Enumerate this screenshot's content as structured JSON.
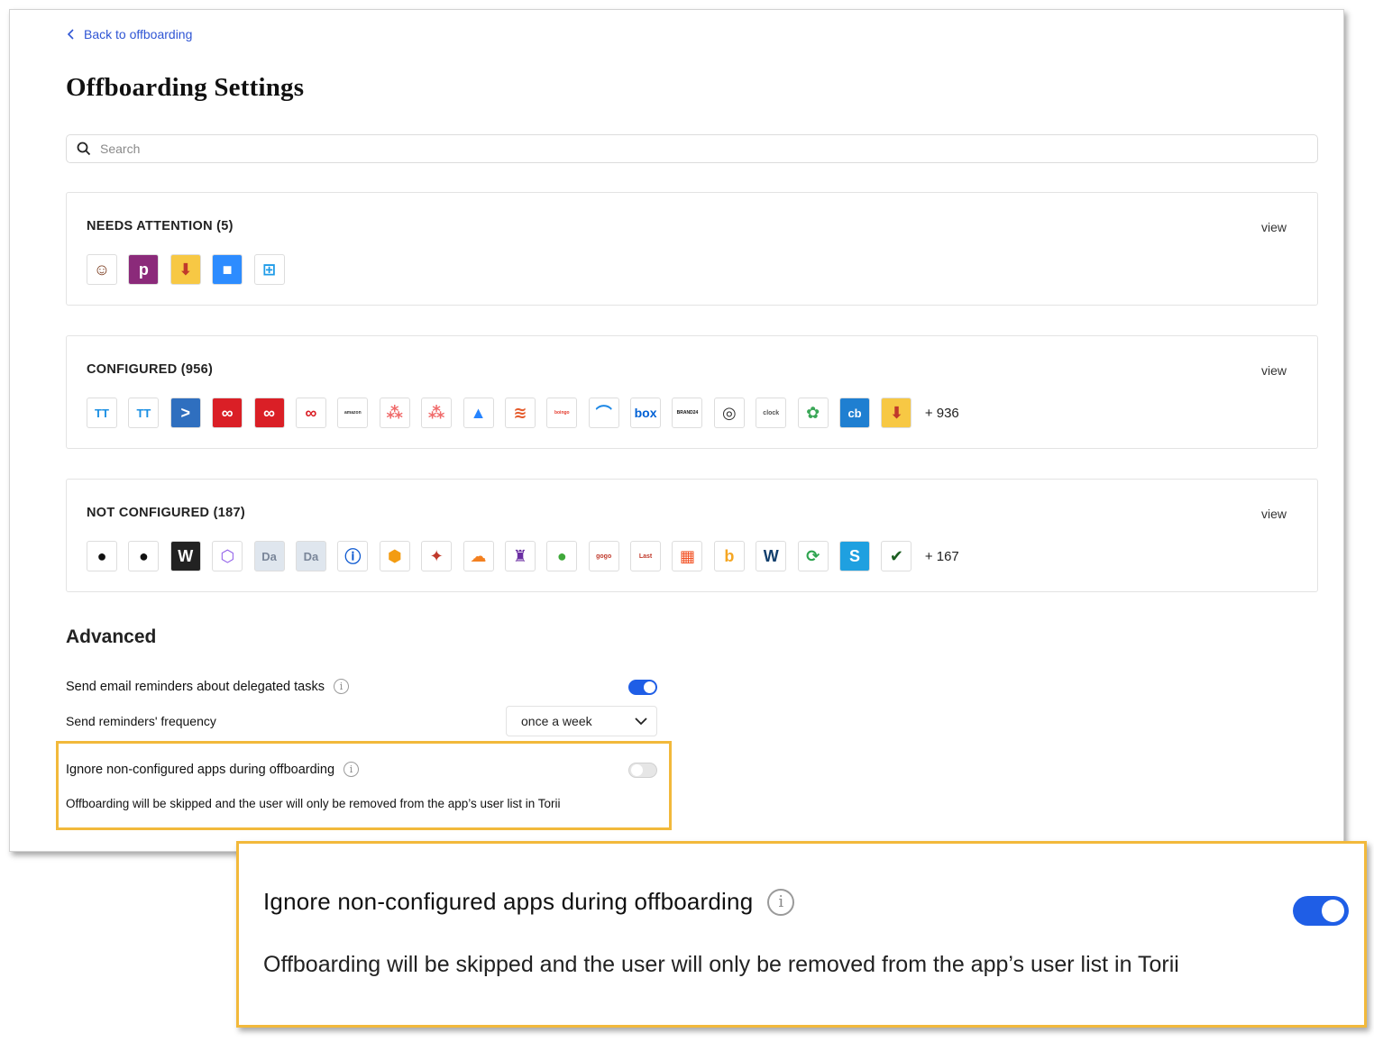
{
  "nav": {
    "back_label": "Back to offboarding"
  },
  "page": {
    "title": "Offboarding Settings"
  },
  "search": {
    "placeholder": "Search"
  },
  "sections": [
    {
      "title": "NEEDS ATTENTION (5)",
      "view_label": "view",
      "more": "",
      "apps": [
        {
          "name": "avatar-app",
          "text": "☺",
          "bg": "#ffffff",
          "fg": "#7a3b1e"
        },
        {
          "name": "p-app",
          "text": "p",
          "bg": "#8b2a7a",
          "fg": "#ffffff"
        },
        {
          "name": "download-app",
          "text": "⬇",
          "bg": "#f7c844",
          "fg": "#c0392b"
        },
        {
          "name": "zoom-app",
          "text": "■",
          "bg": "#2d8cff",
          "fg": "#ffffff"
        },
        {
          "name": "windows-app",
          "text": "⊞",
          "bg": "#ffffff",
          "fg": "#1e9be8"
        }
      ]
    },
    {
      "title": "CONFIGURED (956)",
      "view_label": "view",
      "more": "+ 936",
      "apps": [
        {
          "name": "tt-app-1",
          "text": "TT",
          "bg": "#ffffff",
          "fg": "#1a8fe3"
        },
        {
          "name": "tt-app-2",
          "text": "TT",
          "bg": "#ffffff",
          "fg": "#1a8fe3"
        },
        {
          "name": "arrow-app",
          "text": ">",
          "bg": "#2f6fbf",
          "fg": "#ffffff"
        },
        {
          "name": "adobe-cc-app-1",
          "text": "∞",
          "bg": "#da1f26",
          "fg": "#ffffff"
        },
        {
          "name": "adobe-cc-app-2",
          "text": "∞",
          "bg": "#da1f26",
          "fg": "#ffffff"
        },
        {
          "name": "adobe-cc-app-3",
          "text": "∞",
          "bg": "#ffffff",
          "fg": "#da1f26"
        },
        {
          "name": "amazon-app",
          "text": "amazon",
          "bg": "#ffffff",
          "fg": "#333333"
        },
        {
          "name": "asana-app-1",
          "text": "⁂",
          "bg": "#ffffff",
          "fg": "#f06a6a"
        },
        {
          "name": "asana-app-2",
          "text": "⁂",
          "bg": "#ffffff",
          "fg": "#f06a6a"
        },
        {
          "name": "atlassian-app",
          "text": "▲",
          "bg": "#ffffff",
          "fg": "#2684ff"
        },
        {
          "name": "layers-app",
          "text": "≋",
          "bg": "#ffffff",
          "fg": "#e55b2c"
        },
        {
          "name": "boingo-app",
          "text": "boingo",
          "bg": "#ffffff",
          "fg": "#e43b2d"
        },
        {
          "name": "bird-app",
          "text": "⌒",
          "bg": "#ffffff",
          "fg": "#1e88e5"
        },
        {
          "name": "box-app",
          "text": "box",
          "bg": "#ffffff",
          "fg": "#0061d5"
        },
        {
          "name": "brand-app",
          "text": "BRAND24",
          "bg": "#ffffff",
          "fg": "#111111"
        },
        {
          "name": "circle-app",
          "text": "◎",
          "bg": "#ffffff",
          "fg": "#333333"
        },
        {
          "name": "clockify-app",
          "text": "clock",
          "bg": "#ffffff",
          "fg": "#555555"
        },
        {
          "name": "flower-app",
          "text": "✿",
          "bg": "#ffffff",
          "fg": "#3aa757"
        },
        {
          "name": "cb-app",
          "text": "cb",
          "bg": "#1f7fd1",
          "fg": "#ffffff"
        },
        {
          "name": "download-app-2",
          "text": "⬇",
          "bg": "#f7c844",
          "fg": "#c0392b"
        }
      ]
    },
    {
      "title": "NOT CONFIGURED (187)",
      "view_label": "view",
      "more": "+ 167",
      "apps": [
        {
          "name": "github-app-1",
          "text": "●",
          "bg": "#ffffff",
          "fg": "#111111"
        },
        {
          "name": "github-app-2",
          "text": "●",
          "bg": "#ffffff",
          "fg": "#111111"
        },
        {
          "name": "wordpress-app",
          "text": "W",
          "bg": "#222222",
          "fg": "#ffffff"
        },
        {
          "name": "hexagon-app",
          "text": "⬡",
          "bg": "#ffffff",
          "fg": "#8e5be8"
        },
        {
          "name": "da-app-1",
          "text": "Da",
          "bg": "#dfe6ee",
          "fg": "#7a8699"
        },
        {
          "name": "da-app-2",
          "text": "Da",
          "bg": "#dfe6ee",
          "fg": "#7a8699"
        },
        {
          "name": "onepassword-app",
          "text": "ⓘ",
          "bg": "#ffffff",
          "fg": "#0a57d0"
        },
        {
          "name": "box3d-app",
          "text": "⬢",
          "bg": "#ffffff",
          "fg": "#f39c12"
        },
        {
          "name": "figure-app",
          "text": "✦",
          "bg": "#ffffff",
          "fg": "#c0392b"
        },
        {
          "name": "cloudflare-app",
          "text": "☁",
          "bg": "#ffffff",
          "fg": "#f38020"
        },
        {
          "name": "purple-app",
          "text": "♜",
          "bg": "#ffffff",
          "fg": "#6b2fa3"
        },
        {
          "name": "evernote-app",
          "text": "●",
          "bg": "#ffffff",
          "fg": "#3fa83a"
        },
        {
          "name": "gogo-app",
          "text": "gogo",
          "bg": "#ffffff",
          "fg": "#c0392b"
        },
        {
          "name": "lastpass-app",
          "text": "Last",
          "bg": "#ffffff",
          "fg": "#c0392b"
        },
        {
          "name": "microsoft-app",
          "text": "▦",
          "bg": "#ffffff",
          "fg": "#f25022"
        },
        {
          "name": "bing-app",
          "text": "b",
          "bg": "#ffffff",
          "fg": "#f5a623"
        },
        {
          "name": "ovh-app",
          "text": "W",
          "bg": "#ffffff",
          "fg": "#123f6d"
        },
        {
          "name": "sync-app",
          "text": "⟳",
          "bg": "#ffffff",
          "fg": "#2ea44f"
        },
        {
          "name": "skype-app",
          "text": "S",
          "bg": "#1fa0e0",
          "fg": "#ffffff"
        },
        {
          "name": "plant-app",
          "text": "✔",
          "bg": "#ffffff",
          "fg": "#1b5e20"
        }
      ]
    }
  ],
  "advanced": {
    "title": "Advanced",
    "email_reminders_label": "Send email reminders about delegated tasks",
    "email_reminders_on": true,
    "frequency_label": "Send reminders' frequency",
    "frequency_value": "once a week",
    "ignore_label": "Ignore non-configured apps during offboarding",
    "ignore_on": false,
    "ignore_desc": "Offboarding will be skipped and the user will only be removed from the app’s user list in Torii"
  },
  "callout": {
    "label": "Ignore non-configured apps during offboarding",
    "desc": "Offboarding will be skipped and the user will only be removed from the app’s user list in Torii",
    "toggle_on": true
  },
  "colors": {
    "accent": "#1f5ee6",
    "link": "#2f55d4",
    "highlight": "#f2b93b"
  }
}
